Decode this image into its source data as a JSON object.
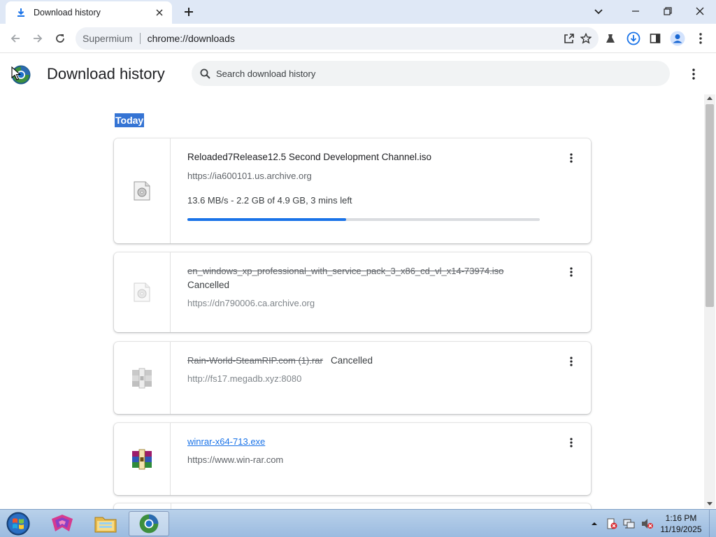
{
  "browser": {
    "tab_title": "Download history",
    "omnibox_host": "Supermium",
    "omnibox_url": "chrome://downloads"
  },
  "page": {
    "title": "Download history",
    "search_placeholder": "Search download history"
  },
  "downloads": {
    "date_header": "Today",
    "items": [
      {
        "file_name": "Reloaded7Release12.5 Second Development Channel.iso",
        "url": "https://ia600101.us.archive.org",
        "status": "13.6 MB/s - 2.2 GB of 4.9 GB, 3 mins left",
        "progress": 0.45,
        "icon": "disc-file-icon"
      },
      {
        "file_name": "en_windows_xp_professional_with_service_pack_3_x86_cd_vl_x14-73974.iso",
        "status": "Cancelled",
        "url": "https://dn790006.ca.archive.org",
        "icon": "disc-file-icon"
      },
      {
        "file_name": "Rain-World-SteamRIP.com (1).rar",
        "status": "Cancelled",
        "url": "http://fs17.megadb.xyz:8080",
        "icon": "archive-file-icon"
      },
      {
        "file_name": "winrar-x64-713.exe",
        "url": "https://www.win-rar.com",
        "icon": "winrar-icon"
      }
    ]
  },
  "taskbar": {
    "time": "1:16 PM",
    "date": "11/19/2025"
  },
  "colors": {
    "accent": "#1a73e8",
    "selection": "#3574d4",
    "titlebar": "#dfe8f6",
    "taskbar": "#b9d1ea"
  }
}
